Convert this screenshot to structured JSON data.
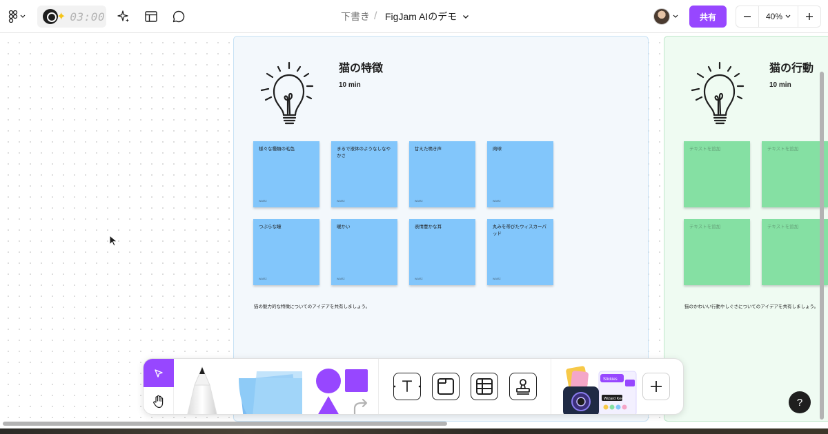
{
  "topbar": {
    "timer": "03:00",
    "breadcrumb": {
      "draft": "下書き",
      "separator": "/",
      "file_name": "FigJam AIのデモ"
    },
    "share_label": "共有",
    "zoom": "40%"
  },
  "colors": {
    "accent": "#9747ff",
    "section_blue": "#f3f8fc",
    "section_green": "#effbf2",
    "sticky_blue": "#82c6fb",
    "sticky_green": "#85e0a3"
  },
  "sections": [
    {
      "title": "猫の特徴",
      "duration": "10 min",
      "description": "猫の魅力的な特徴についてのアイデアを共有しましょう。",
      "notes": [
        {
          "text": "様々な種類の毛色",
          "author": "wantz"
        },
        {
          "text": "まるで液体のようなしなやかさ",
          "author": "wantz"
        },
        {
          "text": "甘えた鳴き声",
          "author": "wantz"
        },
        {
          "text": "肉球",
          "author": "wantz"
        },
        {
          "text": "つぶらな瞳",
          "author": "wantz"
        },
        {
          "text": "暖かい",
          "author": "wantz"
        },
        {
          "text": "表情豊かな耳",
          "author": "wantz"
        },
        {
          "text": "丸みを帯びたウィスカーパッド",
          "author": "wantz"
        }
      ]
    },
    {
      "title": "猫の行動",
      "duration": "10 min",
      "description": "猫のかわいい行動やしぐさについてのアイデアを共有しましょう。",
      "notes": [
        {
          "text": "テキストを追加"
        },
        {
          "text": "テキストを追加"
        },
        {
          "text": "テキストを追加"
        },
        {
          "text": "テキストを追加"
        }
      ]
    }
  ],
  "toolbar": {
    "widget_labels": [
      "Stickies",
      "Wizard Keel"
    ],
    "icons": [
      "cursor-icon",
      "hand-icon",
      "marker-icon",
      "sticky-note-icon",
      "circle-shape-icon",
      "square-shape-icon",
      "triangle-shape-icon",
      "connector-arrow-icon",
      "text-icon",
      "section-icon",
      "table-icon",
      "stamp-icon",
      "widget-icon",
      "plus-icon"
    ]
  },
  "help_label": "?"
}
